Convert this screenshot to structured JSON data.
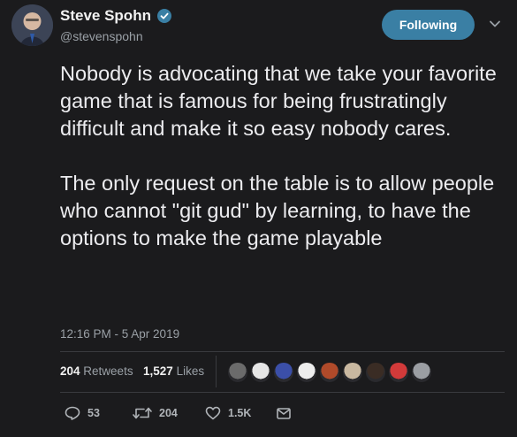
{
  "author": {
    "name": "Steve Spohn",
    "handle": "@stevenspohn",
    "verified_icon": "verified-badge-icon"
  },
  "follow_button": {
    "label": "Following"
  },
  "menu_icon": "chevron-down-icon",
  "tweet": {
    "text": "Nobody is advocating that we take your favorite game that is famous for being frustratingly difficult and make it so easy nobody cares.\n\nThe only request on the table is to allow people who cannot \"git gud\" by learning, to have the options to make the game playable",
    "timestamp": "12:16 PM - 5 Apr 2019"
  },
  "stats": {
    "retweets_count": "204",
    "retweets_label": "Retweets",
    "likes_count": "1,527",
    "likes_label": "Likes"
  },
  "likers": [
    {
      "name": "liker-avatar-1",
      "color": "#6b6b6b"
    },
    {
      "name": "liker-avatar-2",
      "color": "#e6e6e6"
    },
    {
      "name": "liker-avatar-3",
      "color": "#3b4fa8"
    },
    {
      "name": "liker-avatar-4",
      "color": "#ededed"
    },
    {
      "name": "liker-avatar-5",
      "color": "#b04a2a"
    },
    {
      "name": "liker-avatar-6",
      "color": "#c9b8a0"
    },
    {
      "name": "liker-avatar-7",
      "color": "#3a2c24"
    },
    {
      "name": "liker-avatar-8",
      "color": "#d23a3a"
    },
    {
      "name": "liker-avatar-9",
      "color": "#9b9ea3"
    }
  ],
  "actions": {
    "reply_count": "53",
    "retweet_count": "204",
    "like_count": "1.5K"
  },
  "colors": {
    "background": "#1b1b1d",
    "follow_button": "#3a7fa4",
    "verified": "#3a7fa4"
  }
}
